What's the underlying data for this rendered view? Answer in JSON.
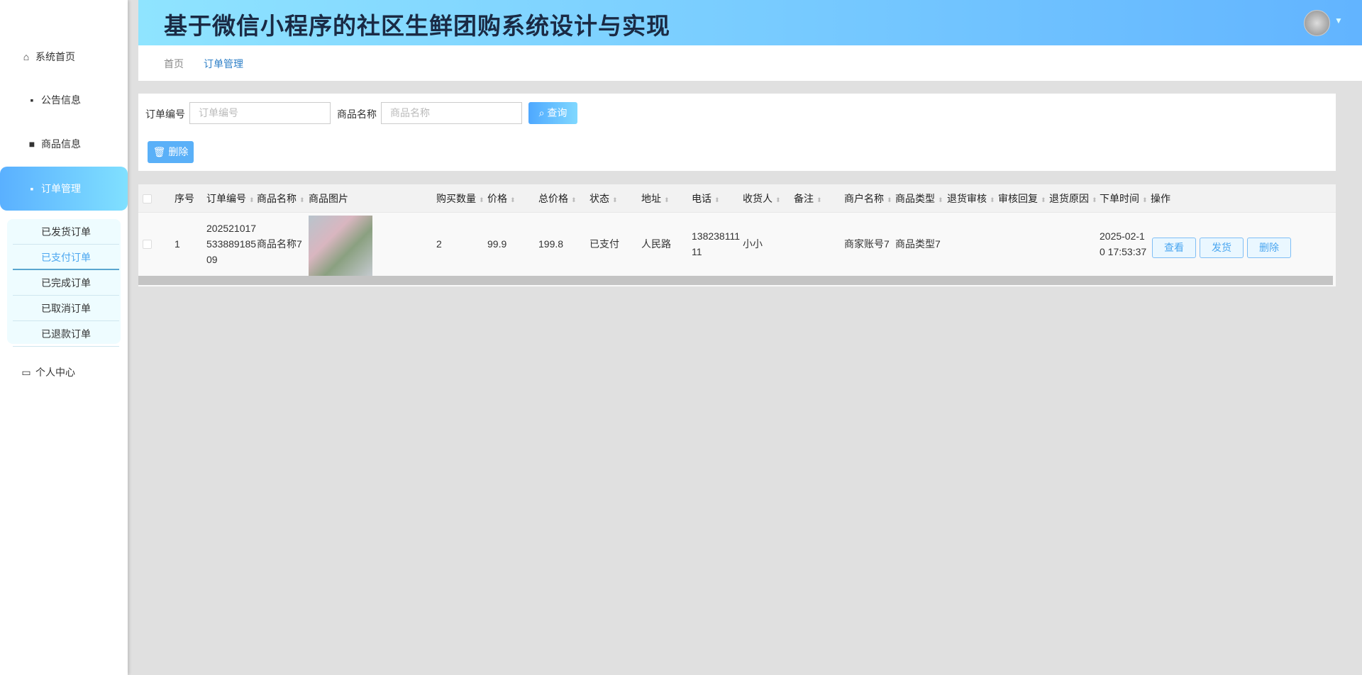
{
  "app": {
    "title": "基于微信小程序的社区生鲜团购系统设计与实现"
  },
  "sidebar": {
    "items": [
      {
        "label": "系统首页",
        "icon": "home-icon"
      },
      {
        "label": "公告信息",
        "icon": "grid-icon"
      },
      {
        "label": "商品信息",
        "icon": "briefcase-icon"
      },
      {
        "label": "订单管理",
        "icon": "grid-icon"
      },
      {
        "label": "个人中心",
        "icon": "card-icon"
      }
    ],
    "submenu": [
      "已发货订单",
      "已支付订单",
      "已完成订单",
      "已取消订单",
      "已退款订单"
    ]
  },
  "breadcrumb": [
    "首页",
    "订单管理"
  ],
  "search": {
    "order_label": "订单编号",
    "order_placeholder": "订单编号",
    "product_label": "商品名称",
    "product_placeholder": "商品名称",
    "query_button": "查询",
    "delete_button": "删除"
  },
  "table": {
    "columns": [
      "序号",
      "订单编号",
      "商品名称",
      "商品图片",
      "购买数量",
      "价格",
      "总价格",
      "状态",
      "地址",
      "电话",
      "收货人",
      "备注",
      "商户名称",
      "商品类型",
      "退货审核",
      "审核回复",
      "退货原因",
      "下单时间",
      "操作"
    ],
    "rows": [
      {
        "index": "1",
        "order_no": "202521017533889185 09",
        "order_l1": "202521017",
        "order_l2": "533889185",
        "order_l3": "09",
        "product": "商品名称7",
        "qty": "2",
        "price": "99.9",
        "total": "199.8",
        "status": "已支付",
        "address": "人民路",
        "phone_l1": "138238111",
        "phone_l2": "11",
        "receiver": "小小",
        "remark": "",
        "merchant": "商家账号7",
        "type": "商品类型7",
        "return_review": "",
        "review_reply": "",
        "return_reason": "",
        "time_l1": "2025-02-1",
        "time_l2": "0 17:53:37",
        "actions": [
          "查看",
          "发货",
          "删除"
        ]
      }
    ]
  },
  "colors": {
    "accent": "#4ea8ff",
    "active_submenu": "#4aa6f0"
  }
}
